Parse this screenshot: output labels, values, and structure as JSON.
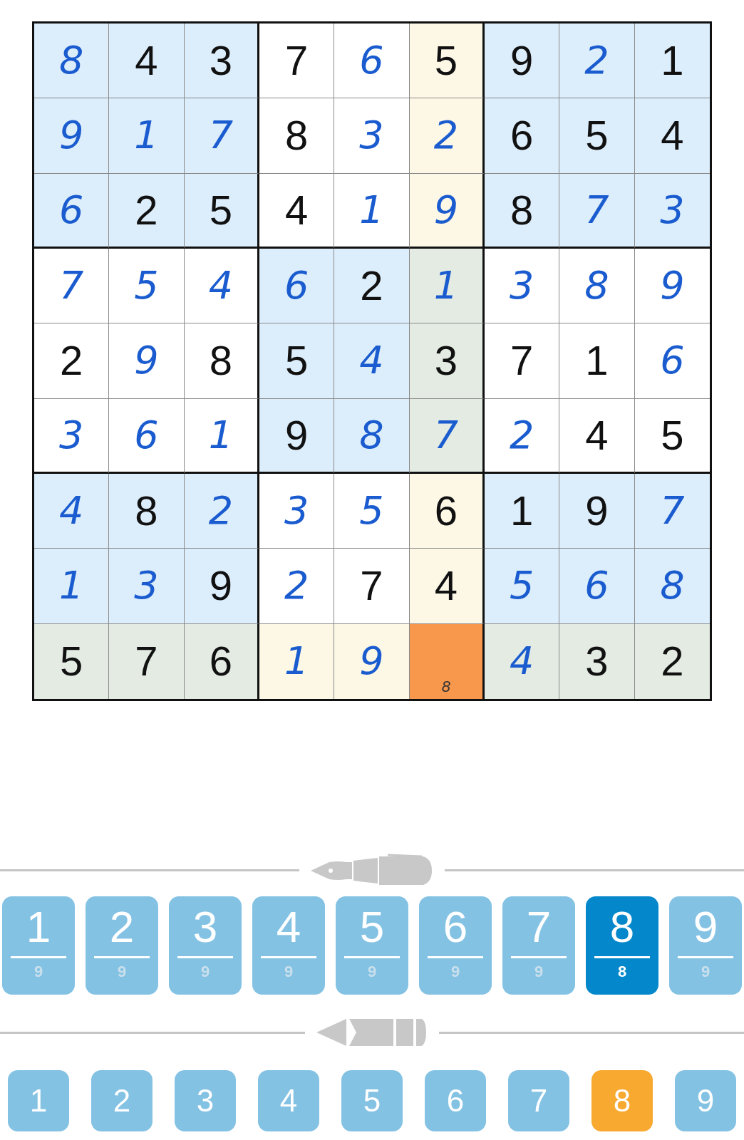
{
  "grid": {
    "rows": [
      [
        {
          "value": "8",
          "given": false,
          "related": false,
          "selected": false
        },
        {
          "value": "4",
          "given": true,
          "related": false,
          "selected": false
        },
        {
          "value": "3",
          "given": true,
          "related": false,
          "selected": false
        },
        {
          "value": "7",
          "given": true,
          "related": false,
          "selected": false
        },
        {
          "value": "6",
          "given": false,
          "related": false,
          "selected": false
        },
        {
          "value": "5",
          "given": true,
          "related": true,
          "selected": false
        },
        {
          "value": "9",
          "given": true,
          "related": false,
          "selected": false
        },
        {
          "value": "2",
          "given": false,
          "related": false,
          "selected": false
        },
        {
          "value": "1",
          "given": true,
          "related": false,
          "selected": false
        }
      ],
      [
        {
          "value": "9",
          "given": false,
          "related": false,
          "selected": false
        },
        {
          "value": "1",
          "given": false,
          "related": false,
          "selected": false
        },
        {
          "value": "7",
          "given": false,
          "related": false,
          "selected": false
        },
        {
          "value": "8",
          "given": true,
          "related": false,
          "selected": false
        },
        {
          "value": "3",
          "given": false,
          "related": false,
          "selected": false
        },
        {
          "value": "2",
          "given": false,
          "related": true,
          "selected": false
        },
        {
          "value": "6",
          "given": true,
          "related": false,
          "selected": false
        },
        {
          "value": "5",
          "given": true,
          "related": false,
          "selected": false
        },
        {
          "value": "4",
          "given": true,
          "related": false,
          "selected": false
        }
      ],
      [
        {
          "value": "6",
          "given": false,
          "related": false,
          "selected": false
        },
        {
          "value": "2",
          "given": true,
          "related": false,
          "selected": false
        },
        {
          "value": "5",
          "given": true,
          "related": false,
          "selected": false
        },
        {
          "value": "4",
          "given": true,
          "related": false,
          "selected": false
        },
        {
          "value": "1",
          "given": false,
          "related": false,
          "selected": false
        },
        {
          "value": "9",
          "given": false,
          "related": true,
          "selected": false
        },
        {
          "value": "8",
          "given": true,
          "related": false,
          "selected": false
        },
        {
          "value": "7",
          "given": false,
          "related": false,
          "selected": false
        },
        {
          "value": "3",
          "given": false,
          "related": false,
          "selected": false
        }
      ],
      [
        {
          "value": "7",
          "given": false,
          "related": false,
          "selected": false
        },
        {
          "value": "5",
          "given": false,
          "related": false,
          "selected": false
        },
        {
          "value": "4",
          "given": false,
          "related": false,
          "selected": false
        },
        {
          "value": "6",
          "given": false,
          "related": false,
          "selected": false
        },
        {
          "value": "2",
          "given": true,
          "related": false,
          "selected": false
        },
        {
          "value": "1",
          "given": false,
          "related": true,
          "selected": false
        },
        {
          "value": "3",
          "given": false,
          "related": false,
          "selected": false
        },
        {
          "value": "8",
          "given": false,
          "related": false,
          "selected": false
        },
        {
          "value": "9",
          "given": false,
          "related": false,
          "selected": false
        }
      ],
      [
        {
          "value": "2",
          "given": true,
          "related": false,
          "selected": false
        },
        {
          "value": "9",
          "given": false,
          "related": false,
          "selected": false
        },
        {
          "value": "8",
          "given": true,
          "related": false,
          "selected": false
        },
        {
          "value": "5",
          "given": true,
          "related": false,
          "selected": false
        },
        {
          "value": "4",
          "given": false,
          "related": false,
          "selected": false
        },
        {
          "value": "3",
          "given": true,
          "related": true,
          "selected": false
        },
        {
          "value": "7",
          "given": true,
          "related": false,
          "selected": false
        },
        {
          "value": "1",
          "given": true,
          "related": false,
          "selected": false
        },
        {
          "value": "6",
          "given": false,
          "related": false,
          "selected": false
        }
      ],
      [
        {
          "value": "3",
          "given": false,
          "related": false,
          "selected": false
        },
        {
          "value": "6",
          "given": false,
          "related": false,
          "selected": false
        },
        {
          "value": "1",
          "given": false,
          "related": false,
          "selected": false
        },
        {
          "value": "9",
          "given": true,
          "related": false,
          "selected": false
        },
        {
          "value": "8",
          "given": false,
          "related": false,
          "selected": false
        },
        {
          "value": "7",
          "given": false,
          "related": true,
          "selected": false
        },
        {
          "value": "2",
          "given": false,
          "related": false,
          "selected": false
        },
        {
          "value": "4",
          "given": true,
          "related": false,
          "selected": false
        },
        {
          "value": "5",
          "given": true,
          "related": false,
          "selected": false
        }
      ],
      [
        {
          "value": "4",
          "given": false,
          "related": false,
          "selected": false
        },
        {
          "value": "8",
          "given": true,
          "related": false,
          "selected": false
        },
        {
          "value": "2",
          "given": false,
          "related": false,
          "selected": false
        },
        {
          "value": "3",
          "given": false,
          "related": false,
          "selected": false
        },
        {
          "value": "5",
          "given": false,
          "related": false,
          "selected": false
        },
        {
          "value": "6",
          "given": true,
          "related": true,
          "selected": false
        },
        {
          "value": "1",
          "given": true,
          "related": false,
          "selected": false
        },
        {
          "value": "9",
          "given": true,
          "related": false,
          "selected": false
        },
        {
          "value": "7",
          "given": false,
          "related": false,
          "selected": false
        }
      ],
      [
        {
          "value": "1",
          "given": false,
          "related": false,
          "selected": false
        },
        {
          "value": "3",
          "given": false,
          "related": false,
          "selected": false
        },
        {
          "value": "9",
          "given": true,
          "related": false,
          "selected": false
        },
        {
          "value": "2",
          "given": false,
          "related": false,
          "selected": false
        },
        {
          "value": "7",
          "given": true,
          "related": false,
          "selected": false
        },
        {
          "value": "4",
          "given": true,
          "related": true,
          "selected": false
        },
        {
          "value": "5",
          "given": false,
          "related": false,
          "selected": false
        },
        {
          "value": "6",
          "given": false,
          "related": false,
          "selected": false
        },
        {
          "value": "8",
          "given": false,
          "related": false,
          "selected": false
        }
      ],
      [
        {
          "value": "5",
          "given": true,
          "related": true,
          "selected": false
        },
        {
          "value": "7",
          "given": true,
          "related": true,
          "selected": false
        },
        {
          "value": "6",
          "given": true,
          "related": true,
          "selected": false
        },
        {
          "value": "1",
          "given": false,
          "related": true,
          "selected": false
        },
        {
          "value": "9",
          "given": false,
          "related": true,
          "selected": false
        },
        {
          "notes": [
            "8"
          ],
          "selected": true
        },
        {
          "value": "4",
          "given": false,
          "related": true,
          "selected": false
        },
        {
          "value": "3",
          "given": true,
          "related": true,
          "selected": false
        },
        {
          "value": "2",
          "given": true,
          "related": true,
          "selected": false
        }
      ]
    ]
  },
  "pen_pad": [
    {
      "digit": "1",
      "count": "9",
      "selected": false
    },
    {
      "digit": "2",
      "count": "9",
      "selected": false
    },
    {
      "digit": "3",
      "count": "9",
      "selected": false
    },
    {
      "digit": "4",
      "count": "9",
      "selected": false
    },
    {
      "digit": "5",
      "count": "9",
      "selected": false
    },
    {
      "digit": "6",
      "count": "9",
      "selected": false
    },
    {
      "digit": "7",
      "count": "9",
      "selected": false
    },
    {
      "digit": "8",
      "count": "8",
      "selected": true
    },
    {
      "digit": "9",
      "count": "9",
      "selected": false
    }
  ],
  "pencil_pad": [
    {
      "digit": "1",
      "selected": false
    },
    {
      "digit": "2",
      "selected": false
    },
    {
      "digit": "3",
      "selected": false
    },
    {
      "digit": "4",
      "selected": false
    },
    {
      "digit": "5",
      "selected": false
    },
    {
      "digit": "6",
      "selected": false
    },
    {
      "digit": "7",
      "selected": false
    },
    {
      "digit": "8",
      "selected": true
    },
    {
      "digit": "9",
      "selected": false
    }
  ]
}
